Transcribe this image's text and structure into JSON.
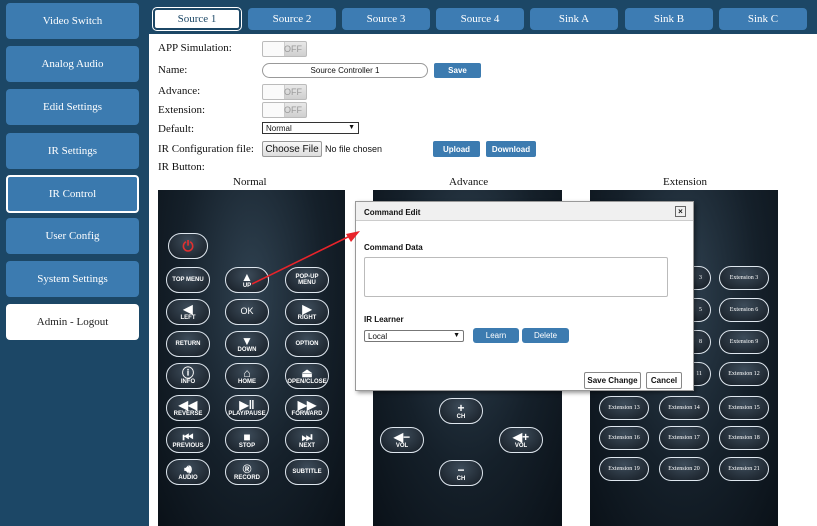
{
  "sidebar": {
    "items": [
      {
        "label": "Video Switch"
      },
      {
        "label": "Analog Audio"
      },
      {
        "label": "Edid Settings"
      },
      {
        "label": "IR Settings"
      },
      {
        "label": "IR Control"
      },
      {
        "label": "User Config"
      },
      {
        "label": "System Settings"
      },
      {
        "label": "Admin - Logout"
      }
    ],
    "active": "IR Control"
  },
  "tabs": [
    {
      "label": "Source 1"
    },
    {
      "label": "Source 2"
    },
    {
      "label": "Source 3"
    },
    {
      "label": "Source 4"
    },
    {
      "label": "Sink A"
    },
    {
      "label": "Sink B"
    },
    {
      "label": "Sink C"
    }
  ],
  "form": {
    "app_simulation_label": "APP Simulation:",
    "app_simulation_value": "OFF",
    "name_label": "Name:",
    "name_value": "Source Controller 1",
    "save_label": "Save",
    "advance_label": "Advance:",
    "advance_value": "OFF",
    "extension_label": "Extension:",
    "extension_value": "OFF",
    "default_label": "Default:",
    "default_value": "Normal",
    "ir_config_label": "IR Configuration file:",
    "choose_file_label": "Choose File",
    "no_file_text": "No file chosen",
    "upload_label": "Upload",
    "download_label": "Download",
    "ir_button_label": "IR Button:"
  },
  "columns": {
    "normal": "Normal",
    "advance": "Advance",
    "extension": "Extension"
  },
  "normal_buttons": {
    "top_menu": "TOP MENU",
    "up": "UP",
    "popup_menu_1": "POP-UP",
    "popup_menu_2": "MENU",
    "left": "LEFT",
    "ok": "OK",
    "right": "RIGHT",
    "return": "RETURN",
    "down": "DOWN",
    "option": "OPTION",
    "info": "INFO",
    "home": "HOME",
    "open_close": "OPEN/CLOSE",
    "reverse": "REVERSE",
    "play_pause": "PLAY/PAUSE",
    "forward": "FORWARD",
    "previous": "PREVIOUS",
    "stop": "STOP",
    "next": "NEXT",
    "audio": "AUDIO",
    "record": "RECORD",
    "subtitle": "SUBTITLE"
  },
  "advance_buttons": {
    "ch_up": "CH",
    "vol_down": "VOL",
    "vol_up": "VOL",
    "ch_down": "CH"
  },
  "extension_buttons": [
    "3",
    "Extension 3",
    "5",
    "Extension 6",
    "8",
    "Extension 9",
    "11",
    "Extension 12",
    "Extension 13",
    "Extension 14",
    "Extension 15",
    "Extension 16",
    "Extension 17",
    "Extension 18",
    "Extension 19",
    "Extension 20",
    "Extension 21"
  ],
  "dialog": {
    "title": "Command Edit",
    "close": "×",
    "command_data_label": "Command Data",
    "command_data_value": "",
    "ir_learner_label": "IR Learner",
    "learner_select": "Local",
    "learn_label": "Learn",
    "delete_label": "Delete",
    "save_change_label": "Save Change",
    "cancel_label": "Cancel"
  },
  "colors": {
    "navy": "#1c4766",
    "button_blue": "#3c7bb0",
    "arrow_red": "#e8232a",
    "power_red": "#e03030"
  }
}
